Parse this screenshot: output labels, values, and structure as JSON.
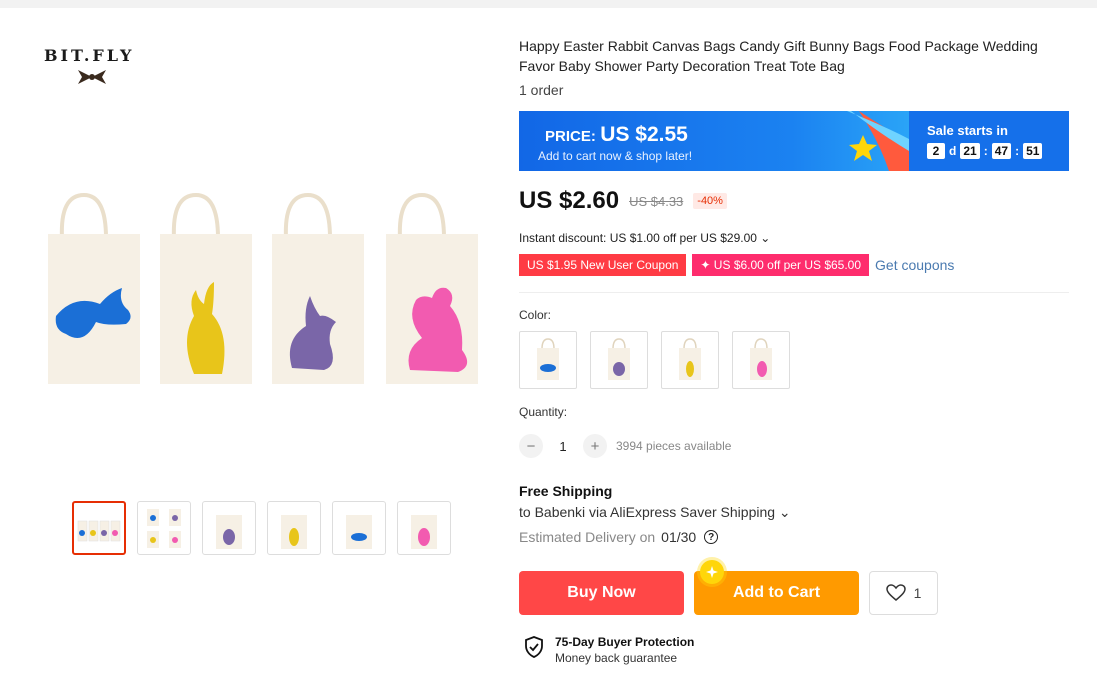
{
  "brand": {
    "name": "BIT.FLY"
  },
  "product": {
    "title": "Happy Easter Rabbit Canvas Bags Candy Gift Bunny Bags Food Package Wedding Favor Baby Shower Party Decoration Treat Tote Bag",
    "orders": "1 order"
  },
  "promo": {
    "price_label": "PRICE:",
    "price_value": "US $2.55",
    "subtitle": "Add to cart now & shop later!",
    "sale_title": "Sale starts in",
    "countdown": {
      "days": "2",
      "days_unit": "d",
      "hours": "21",
      "minutes": "47",
      "seconds": "51",
      "sep": ":"
    }
  },
  "price": {
    "current": "US $2.60",
    "original": "US $4.33",
    "discount": "-40%"
  },
  "instant_discount": "Instant discount: US $1.00 off per US $29.00 ⌄",
  "coupons": {
    "new_user": "US $1.95 New User Coupon",
    "store": "✦ US $6.00 off per US $65.00",
    "get_link": "Get coupons"
  },
  "color": {
    "label": "Color:",
    "options": [
      "blue",
      "purple",
      "yellow",
      "pink"
    ]
  },
  "quantity": {
    "label": "Quantity:",
    "value": "1",
    "minus": "−",
    "plus": "+",
    "available": "3994 pieces available"
  },
  "shipping": {
    "title": "Free Shipping",
    "route": "to Babenki via AliExpress Saver Shipping ⌄",
    "estimated_label": "Estimated Delivery on",
    "estimated_date": "01/30",
    "help_icon": "question-icon"
  },
  "actions": {
    "buy_now": "Buy Now",
    "add_to_cart": "Add to Cart",
    "wishlist_count": "1"
  },
  "protection": {
    "title": "75-Day Buyer Protection",
    "subtitle": "Money back guarantee"
  },
  "colors": {
    "buy": "#ff4747",
    "cart": "#ff9a00",
    "bunny_blue": "#1b6fd6",
    "bunny_yellow": "#e8c51a",
    "bunny_purple": "#7a66a8",
    "bunny_pink": "#f25bb0",
    "bag": "#f6f0e5"
  }
}
